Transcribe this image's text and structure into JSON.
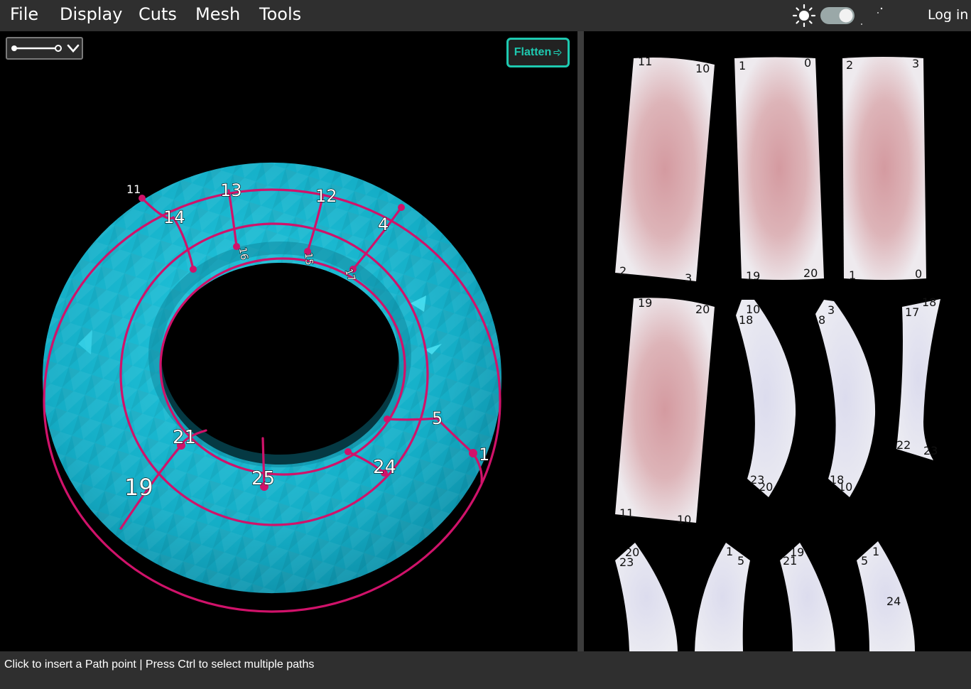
{
  "menu": {
    "items": [
      {
        "label": "File"
      },
      {
        "label": "Display"
      },
      {
        "label": "Cuts"
      },
      {
        "label": "Mesh"
      },
      {
        "label": "Tools"
      }
    ],
    "login_label": "Log in"
  },
  "theme": {
    "icons": [
      "sun-icon",
      "moon-icon"
    ],
    "dark_mode": true
  },
  "toolbar": {
    "flatten_label": "Flatten",
    "flatten_icon": "arrow-right-icon",
    "path_mode_icon": "path-icon"
  },
  "colors": {
    "mesh": "#16b3cc",
    "cut_path": "#d0126a",
    "accent": "#1ec9b0",
    "patch_fill": "#e8e8ee",
    "patch_stress": "#d49aa0"
  },
  "viewport": {
    "vertex_labels": [
      {
        "id": "11",
        "text": "11"
      },
      {
        "id": "13",
        "text": "13"
      },
      {
        "id": "12",
        "text": "12"
      },
      {
        "id": "14",
        "text": "14"
      },
      {
        "id": "4",
        "text": "4"
      },
      {
        "id": "5",
        "text": "5"
      },
      {
        "id": "1",
        "text": "1"
      },
      {
        "id": "21",
        "text": "21"
      },
      {
        "id": "24",
        "text": "24"
      },
      {
        "id": "25",
        "text": "25"
      },
      {
        "id": "19",
        "text": "19"
      },
      {
        "id": "16",
        "text": "16"
      },
      {
        "id": "15",
        "text": "15"
      },
      {
        "id": "17",
        "text": "17"
      }
    ]
  },
  "patches": [
    {
      "id": "p1",
      "labels": [
        "11",
        "10",
        "2",
        "3"
      ]
    },
    {
      "id": "p2",
      "labels": [
        "1",
        "0",
        "19",
        "20"
      ]
    },
    {
      "id": "p3",
      "labels": [
        "2",
        "3",
        "1",
        "0"
      ]
    },
    {
      "id": "p4",
      "labels": [
        "19",
        "20",
        "11",
        "10"
      ]
    },
    {
      "id": "p5",
      "labels": [
        "10",
        "18",
        "23",
        "20"
      ]
    },
    {
      "id": "p6",
      "labels": [
        "3",
        "8",
        "18",
        "10"
      ]
    },
    {
      "id": "p7",
      "labels": [
        "18",
        "17",
        "22",
        "23"
      ]
    },
    {
      "id": "p8",
      "labels": [
        "20",
        "23"
      ]
    },
    {
      "id": "p9",
      "labels": [
        "1",
        "5"
      ]
    },
    {
      "id": "p10",
      "labels": [
        "19",
        "21"
      ]
    },
    {
      "id": "p11",
      "labels": [
        "1",
        "5",
        "24"
      ]
    }
  ],
  "status": {
    "text": "Click to insert a Path point | Press Ctrl to select multiple paths"
  }
}
